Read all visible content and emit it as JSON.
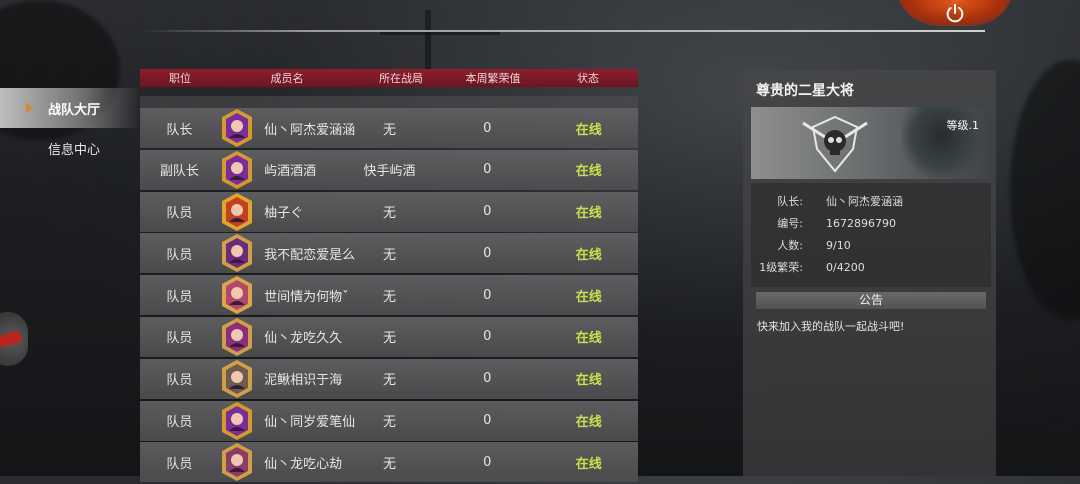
{
  "header": {
    "power_icon": "power-icon"
  },
  "sidebar": {
    "items": [
      {
        "label": "战队大厅",
        "active": true
      },
      {
        "label": "信息中心",
        "active": false
      }
    ]
  },
  "table": {
    "headers": [
      "职位",
      "成员名",
      "所在战局",
      "本周繁荣值",
      "状态"
    ],
    "rows": [
      {
        "role": "队长",
        "name": "仙丶阿杰爱涵涵",
        "game": "无",
        "prosperity": "0",
        "status": "在线"
      },
      {
        "role": "副队长",
        "name": "屿酒酒酒",
        "game": "快手屿酒",
        "prosperity": "0",
        "status": "在线"
      },
      {
        "role": "队员",
        "name": "柚子ぐ",
        "game": "无",
        "prosperity": "0",
        "status": "在线"
      },
      {
        "role": "队员",
        "name": "我不配恋爱是么",
        "game": "无",
        "prosperity": "0",
        "status": "在线"
      },
      {
        "role": "队员",
        "name": "世间情为何物ˇ",
        "game": "无",
        "prosperity": "0",
        "status": "在线"
      },
      {
        "role": "队员",
        "name": "仙丶龙吃久久",
        "game": "无",
        "prosperity": "0",
        "status": "在线"
      },
      {
        "role": "队员",
        "name": "泥鳅相识于海",
        "game": "无",
        "prosperity": "0",
        "status": "在线"
      },
      {
        "role": "队员",
        "name": "仙丶同岁爱笔仙",
        "game": "无",
        "prosperity": "0",
        "status": "在线"
      },
      {
        "role": "队员",
        "name": "仙丶龙吃心劫",
        "game": "无",
        "prosperity": "0",
        "status": "在线"
      }
    ]
  },
  "panel": {
    "title": "尊贵的二星大将",
    "level": "等级.1",
    "stats": [
      {
        "key": "队长:",
        "value": "仙丶阿杰爱涵涵"
      },
      {
        "key": "编号:",
        "value": "1672896790"
      },
      {
        "key": "人数:",
        "value": "9/10"
      },
      {
        "key": "1级繁荣:",
        "value": "0/4200"
      }
    ],
    "notice_title": "公告",
    "notice_text": "快来加入我的战队一起战斗吧!"
  },
  "colors": {
    "accent_header": "#8d1f2e",
    "online": "#c6e24a",
    "power_button": "#e35a1a"
  }
}
